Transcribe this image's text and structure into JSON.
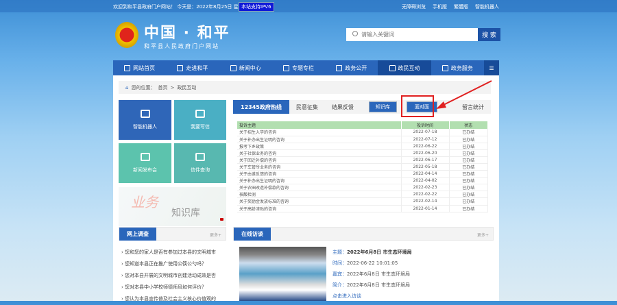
{
  "topbar": {
    "welcome": "欢迎到和平县政府门户网站！ 今天是：2022年8月25日 星期四",
    "ipv6": "本站支持IPV6",
    "links": [
      "无障碍浏览",
      "手机版",
      "繁體版",
      "智能机器人"
    ]
  },
  "header": {
    "title": "中国 · 和平",
    "subtitle": "和平县人民政府门户网站",
    "search_placeholder": "请输入关键词",
    "search_button": "搜 索"
  },
  "nav": [
    {
      "label": "网站首页"
    },
    {
      "label": "走进和平"
    },
    {
      "label": "新闻中心"
    },
    {
      "label": "专题专栏"
    },
    {
      "label": "政务公开"
    },
    {
      "label": "政民互动",
      "active": true
    },
    {
      "label": "政务服务"
    }
  ],
  "breadcrumb": {
    "prefix": "您的位置：",
    "items": [
      "首页",
      ">",
      "政民互动"
    ]
  },
  "tiles": [
    "智能机器人",
    "我要写信",
    "新闻发布会",
    "信件查询"
  ],
  "banner": {
    "text1": "业务",
    "text2": "知识库"
  },
  "tabs": {
    "hotline": "12345政府热线",
    "items": [
      "民意征集",
      "结果反馈"
    ],
    "knowledge": "知识库",
    "face": "面对面",
    "stats": "留言统计"
  },
  "table": {
    "headers": [
      "投诉主题",
      "投诉时间",
      "状态"
    ],
    "rows": [
      [
        "关于招生入学的咨询",
        "2022-07-18",
        "已办结"
      ],
      [
        "关于补办出生证明的咨询",
        "2022-07-12",
        "已办结"
      ],
      [
        "报考下乡政策",
        "2022-06-22",
        "已办结"
      ],
      [
        "关于社保业务的咨询",
        "2022-06-20",
        "已办结"
      ],
      [
        "关于回迁补偿的咨询",
        "2022-06-17",
        "已办结"
      ],
      [
        "关于车管所业务的咨询",
        "2022-05-18",
        "已办结"
      ],
      [
        "关于由谁反馈的咨询",
        "2022-04-14",
        "已办结"
      ],
      [
        "关于补办出生证明的咨询",
        "2022-04-02",
        "已办结"
      ],
      [
        "关于农田改造补偿款的咨询",
        "2022-02-23",
        "已办结"
      ],
      [
        "核酸检测",
        "2022-02-22",
        "已办结"
      ],
      [
        "关于奖励金发放标准的咨询",
        "2022-02-14",
        "已办结"
      ],
      [
        "关于高龄津贴的咨询",
        "2022-01-14",
        "已办结"
      ]
    ]
  },
  "survey": {
    "title": "网上调查",
    "more": "更多+",
    "items": [
      "您和您的家人是否有参加过本县的文明城市",
      "您知道本县正在推广使用公筷公勺吗？",
      "您对本县开展的文明城市创建活动成效是否",
      "您对本县中小学校师德师风如何评价？",
      "您认为本县宣传普及社会主义核心价值观的"
    ]
  },
  "interview": {
    "title": "在线访谈",
    "more": "更多+",
    "topic_label": "主题：",
    "topic": "2022年6月8日 市生态环境局",
    "time_label": "时间：",
    "time": "2022-06-22 10:01:05",
    "guest_label": "嘉宾：",
    "guest": "2022年6月8日 市生态环境局",
    "intro_label": "简介：",
    "intro": "2022年6月8日 市生态环境局",
    "enter": "点击进入访谈"
  },
  "colors": {
    "primary": "#2a66bb",
    "highlight": "#e02020"
  }
}
